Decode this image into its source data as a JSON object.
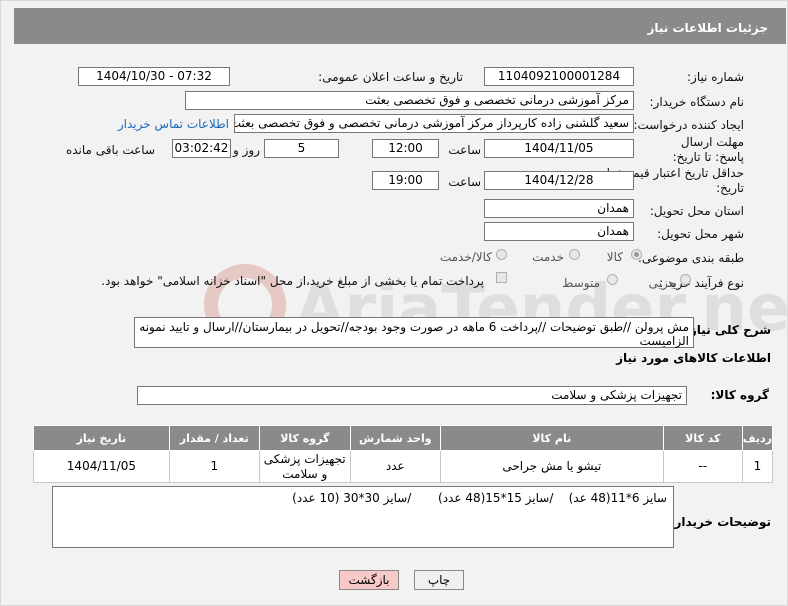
{
  "header": {
    "title": "جزئیات اطلاعات نیاز"
  },
  "fields": {
    "need_number_label": "شماره نیاز:",
    "need_number": "1104092100001284",
    "announce_label": "تاریخ و ساعت اعلان عمومی:",
    "announce_value": "1404/10/30 - 07:32",
    "buyer_org_label": "نام دستگاه خریدار:",
    "buyer_org": "مرکز آموزشی درمانی تخصصی و فوق تخصصی بعثت",
    "requester_label": "ایجاد کننده درخواست:",
    "requester": "سعید گلشنی زاده کارپرداز مرکز آموزشی درمانی تخصصی و فوق تخصصی بعثت",
    "contact_link": "اطلاعات تماس خریدار",
    "reply_deadline_label": "مهلت ارسال پاسخ: تا تاریخ:",
    "reply_date": "1404/11/05",
    "time_label": "ساعت",
    "reply_time": "12:00",
    "days_value": "5",
    "days_label": "روز و",
    "remaining_time": "03:02:42",
    "remaining_label": "ساعت باقی مانده",
    "price_validity_label": "حداقل تاریخ اعتبار قیمت: تا تاریخ:",
    "price_date": "1404/12/28",
    "price_time": "19:00",
    "province_label": "استان محل تحویل:",
    "province": "همدان",
    "city_label": "شهر محل تحویل:",
    "city": "همدان",
    "category_label": "طبقه بندی موضوعی:",
    "category_options": [
      "کالا",
      "خدمت",
      "کالا/خدمت"
    ],
    "process_label": "نوع فرآیند خرید :",
    "process_options": [
      "جزیی",
      "متوسط"
    ],
    "payment_note": "پرداخت تمام یا بخشی از مبلغ خرید،از محل \"اسناد خزانه اسلامی\" خواهد بود."
  },
  "description": {
    "label": "شرح کلی نیاز:",
    "text": "مش پرولن //طبق توضیحات //پرداخت 6 ماهه در صورت وجود بودجه//تحویل در بیمارستان//ارسال و تایید نمونه الزامیست"
  },
  "goods": {
    "section_title": "اطلاعات کالاهای مورد نیاز",
    "group_label": "گروه کالا:",
    "group_value": "تجهیزات پزشکی و سلامت",
    "columns": [
      "ردیف",
      "کد کالا",
      "نام کالا",
      "واحد شمارش",
      "گروه کالا",
      "تعداد / مقدار",
      "تاریخ نیاز"
    ],
    "rows": [
      [
        "1",
        "--",
        "تیشو یا مش جراحی",
        "عدد",
        "تجهیزات پزشکی و سلامت",
        "1",
        "1404/11/05"
      ]
    ]
  },
  "buyer_notes": {
    "label": "توضیحات خریدار:",
    "text": "سایز 6*11(48 عد)    /سایز 15*15(48 عدد)       /سایز 30*30 (10 عدد)"
  },
  "buttons": {
    "print": "چاپ",
    "back": "بازگشت"
  },
  "watermark": {
    "text": "AriaTender.neT"
  },
  "colors": {
    "header_bg": "#8a8a8a",
    "link": "#1a6bb8",
    "back_button": "#f7c9c9"
  }
}
